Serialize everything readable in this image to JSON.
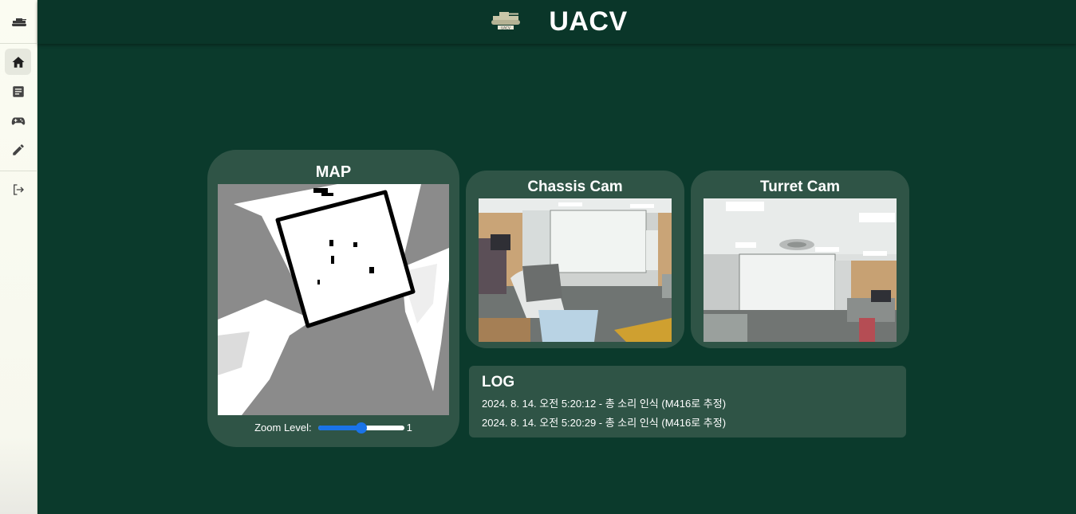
{
  "app": {
    "title": "UACV",
    "logo_text": "UACV"
  },
  "sidebar": {
    "items": [
      {
        "name": "home",
        "icon": "home-icon",
        "active": true
      },
      {
        "name": "logs",
        "icon": "document-icon",
        "active": false
      },
      {
        "name": "control",
        "icon": "gamepad-icon",
        "active": false
      },
      {
        "name": "edit",
        "icon": "pencil-icon",
        "active": false
      },
      {
        "name": "logout",
        "icon": "logout-icon",
        "active": false
      }
    ]
  },
  "map": {
    "title": "MAP",
    "zoom_label": "Zoom Level:",
    "zoom_value": "1",
    "zoom_fraction": 0.5
  },
  "cams": {
    "chassis": {
      "title": "Chassis Cam"
    },
    "turret": {
      "title": "Turret Cam"
    }
  },
  "log": {
    "title": "LOG",
    "entries": [
      "2024. 8. 14. 오전 5:20:12 - 총 소리 인식 (M416로 추정)",
      "2024. 8. 14. 오전 5:20:29 - 총 소리 인식 (M416로 추정)"
    ]
  },
  "colors": {
    "background": "#0b3a2c",
    "header": "#0a3629",
    "card": "#2f5446",
    "sidebar": "#fbfcf2",
    "slider_accent": "#1a73e8"
  }
}
